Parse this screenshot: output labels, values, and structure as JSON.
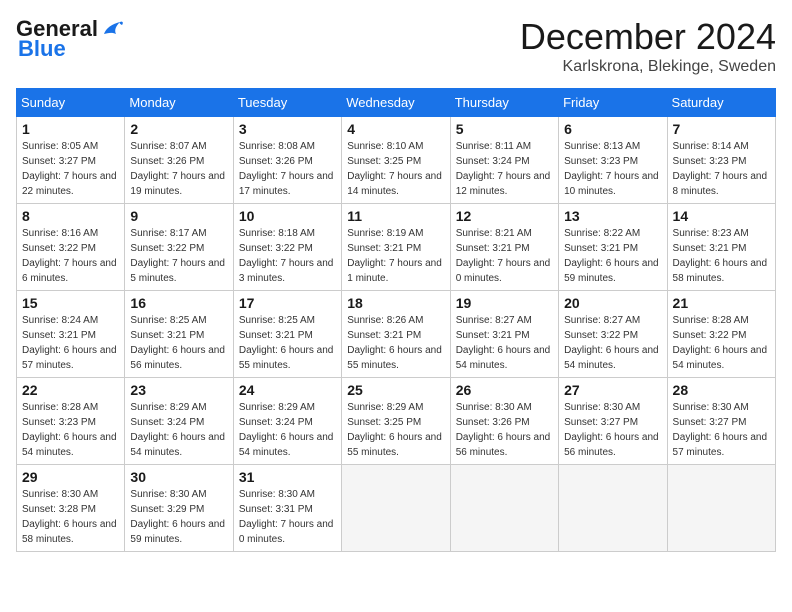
{
  "logo": {
    "text_general": "General",
    "text_blue": "Blue"
  },
  "header": {
    "month": "December 2024",
    "location": "Karlskrona, Blekinge, Sweden"
  },
  "weekdays": [
    "Sunday",
    "Monday",
    "Tuesday",
    "Wednesday",
    "Thursday",
    "Friday",
    "Saturday"
  ],
  "weeks": [
    [
      {
        "day": "1",
        "sunrise": "8:05 AM",
        "sunset": "3:27 PM",
        "daylight": "7 hours and 22 minutes."
      },
      {
        "day": "2",
        "sunrise": "8:07 AM",
        "sunset": "3:26 PM",
        "daylight": "7 hours and 19 minutes."
      },
      {
        "day": "3",
        "sunrise": "8:08 AM",
        "sunset": "3:26 PM",
        "daylight": "7 hours and 17 minutes."
      },
      {
        "day": "4",
        "sunrise": "8:10 AM",
        "sunset": "3:25 PM",
        "daylight": "7 hours and 14 minutes."
      },
      {
        "day": "5",
        "sunrise": "8:11 AM",
        "sunset": "3:24 PM",
        "daylight": "7 hours and 12 minutes."
      },
      {
        "day": "6",
        "sunrise": "8:13 AM",
        "sunset": "3:23 PM",
        "daylight": "7 hours and 10 minutes."
      },
      {
        "day": "7",
        "sunrise": "8:14 AM",
        "sunset": "3:23 PM",
        "daylight": "7 hours and 8 minutes."
      }
    ],
    [
      {
        "day": "8",
        "sunrise": "8:16 AM",
        "sunset": "3:22 PM",
        "daylight": "7 hours and 6 minutes."
      },
      {
        "day": "9",
        "sunrise": "8:17 AM",
        "sunset": "3:22 PM",
        "daylight": "7 hours and 5 minutes."
      },
      {
        "day": "10",
        "sunrise": "8:18 AM",
        "sunset": "3:22 PM",
        "daylight": "7 hours and 3 minutes."
      },
      {
        "day": "11",
        "sunrise": "8:19 AM",
        "sunset": "3:21 PM",
        "daylight": "7 hours and 1 minute."
      },
      {
        "day": "12",
        "sunrise": "8:21 AM",
        "sunset": "3:21 PM",
        "daylight": "7 hours and 0 minutes."
      },
      {
        "day": "13",
        "sunrise": "8:22 AM",
        "sunset": "3:21 PM",
        "daylight": "6 hours and 59 minutes."
      },
      {
        "day": "14",
        "sunrise": "8:23 AM",
        "sunset": "3:21 PM",
        "daylight": "6 hours and 58 minutes."
      }
    ],
    [
      {
        "day": "15",
        "sunrise": "8:24 AM",
        "sunset": "3:21 PM",
        "daylight": "6 hours and 57 minutes."
      },
      {
        "day": "16",
        "sunrise": "8:25 AM",
        "sunset": "3:21 PM",
        "daylight": "6 hours and 56 minutes."
      },
      {
        "day": "17",
        "sunrise": "8:25 AM",
        "sunset": "3:21 PM",
        "daylight": "6 hours and 55 minutes."
      },
      {
        "day": "18",
        "sunrise": "8:26 AM",
        "sunset": "3:21 PM",
        "daylight": "6 hours and 55 minutes."
      },
      {
        "day": "19",
        "sunrise": "8:27 AM",
        "sunset": "3:21 PM",
        "daylight": "6 hours and 54 minutes."
      },
      {
        "day": "20",
        "sunrise": "8:27 AM",
        "sunset": "3:22 PM",
        "daylight": "6 hours and 54 minutes."
      },
      {
        "day": "21",
        "sunrise": "8:28 AM",
        "sunset": "3:22 PM",
        "daylight": "6 hours and 54 minutes."
      }
    ],
    [
      {
        "day": "22",
        "sunrise": "8:28 AM",
        "sunset": "3:23 PM",
        "daylight": "6 hours and 54 minutes."
      },
      {
        "day": "23",
        "sunrise": "8:29 AM",
        "sunset": "3:24 PM",
        "daylight": "6 hours and 54 minutes."
      },
      {
        "day": "24",
        "sunrise": "8:29 AM",
        "sunset": "3:24 PM",
        "daylight": "6 hours and 54 minutes."
      },
      {
        "day": "25",
        "sunrise": "8:29 AM",
        "sunset": "3:25 PM",
        "daylight": "6 hours and 55 minutes."
      },
      {
        "day": "26",
        "sunrise": "8:30 AM",
        "sunset": "3:26 PM",
        "daylight": "6 hours and 56 minutes."
      },
      {
        "day": "27",
        "sunrise": "8:30 AM",
        "sunset": "3:27 PM",
        "daylight": "6 hours and 56 minutes."
      },
      {
        "day": "28",
        "sunrise": "8:30 AM",
        "sunset": "3:27 PM",
        "daylight": "6 hours and 57 minutes."
      }
    ],
    [
      {
        "day": "29",
        "sunrise": "8:30 AM",
        "sunset": "3:28 PM",
        "daylight": "6 hours and 58 minutes."
      },
      {
        "day": "30",
        "sunrise": "8:30 AM",
        "sunset": "3:29 PM",
        "daylight": "6 hours and 59 minutes."
      },
      {
        "day": "31",
        "sunrise": "8:30 AM",
        "sunset": "3:31 PM",
        "daylight": "7 hours and 0 minutes."
      },
      null,
      null,
      null,
      null
    ]
  ]
}
